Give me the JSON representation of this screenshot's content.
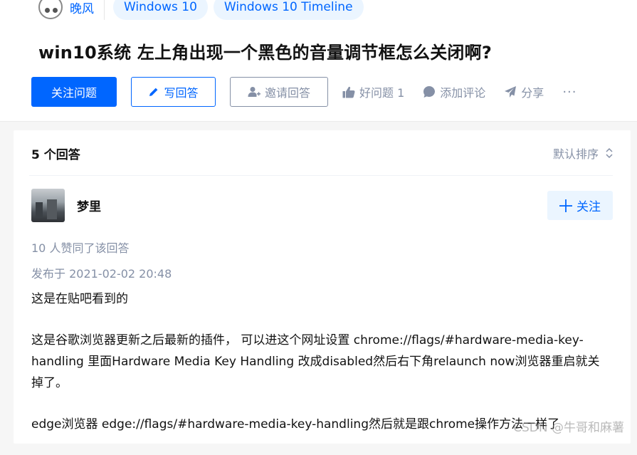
{
  "topics": {
    "first": "晚风",
    "tags": [
      "Windows 10",
      "Windows 10 Timeline"
    ]
  },
  "question": {
    "title": "win10系统 左上角出现一个黑色的音量调节框怎么关闭啊?"
  },
  "actions": {
    "follow": "关注问题",
    "write": "写回答",
    "invite": "邀请回答",
    "good": "好问题 1",
    "comment": "添加评论",
    "share": "分享",
    "more": "···"
  },
  "answers": {
    "count": "5 个回答",
    "sort": "默认排序"
  },
  "answer": {
    "author": "梦里",
    "follow": "关注",
    "votes": "10 人赞同了该回答",
    "published": "发布于 2021-02-02 20:48",
    "paragraphs": [
      "这是在贴吧看到的",
      "这是谷歌浏览器更新之后最新的插件， 可以进这个网址设置 chrome://flags/#hardware-media-key-handling 里面Hardware Media Key Handling 改成disabled然后右下角relaunch now浏览器重启就关掉了。",
      "edge浏览器 edge://flags/#hardware-media-key-handling然后就是跟chrome操作方法一样了"
    ]
  },
  "watermark": "CSDN @牛哥和麻薯",
  "colors": {
    "accent": "#0066ff",
    "muted": "#8590a6",
    "tag_bg": "#ebf5ff"
  }
}
